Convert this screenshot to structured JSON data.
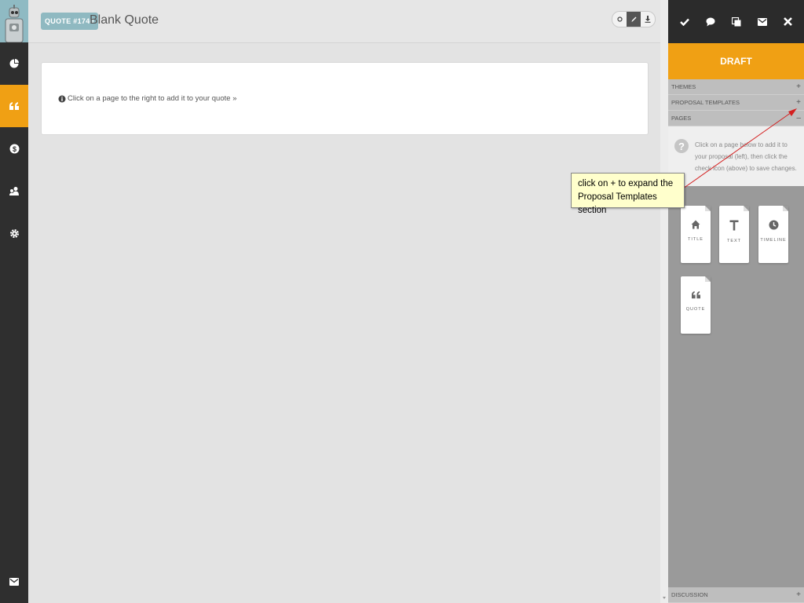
{
  "header": {
    "quote_badge": "QUOTE #1740",
    "title": "Blank Quote"
  },
  "main": {
    "hint": "Click on a page to the right to add it to your quote »"
  },
  "right_panel": {
    "status": "DRAFT",
    "sections": {
      "themes": "THEMES",
      "proposal_templates": "PROPOSAL TEMPLATES",
      "pages": "PAGES",
      "discussion": "DISCUSSION"
    },
    "pages_info": "Click on a page below to add it to your proposal (left), then click the check icon (above) to save changes.",
    "tiles": [
      {
        "label": "TITLE",
        "icon": "home-icon"
      },
      {
        "label": "TEXT",
        "icon": "text-t-icon"
      },
      {
        "label": "TIMELINE",
        "icon": "clock-icon"
      },
      {
        "label": "QUOTE",
        "icon": "quote-icon"
      }
    ]
  },
  "callout": {
    "line1": "click on + to expand the",
    "line2": "Proposal Templates section"
  },
  "colors": {
    "accent": "#f0a014",
    "sidebar": "#2f2f2f",
    "badge": "#8fb9c1"
  }
}
